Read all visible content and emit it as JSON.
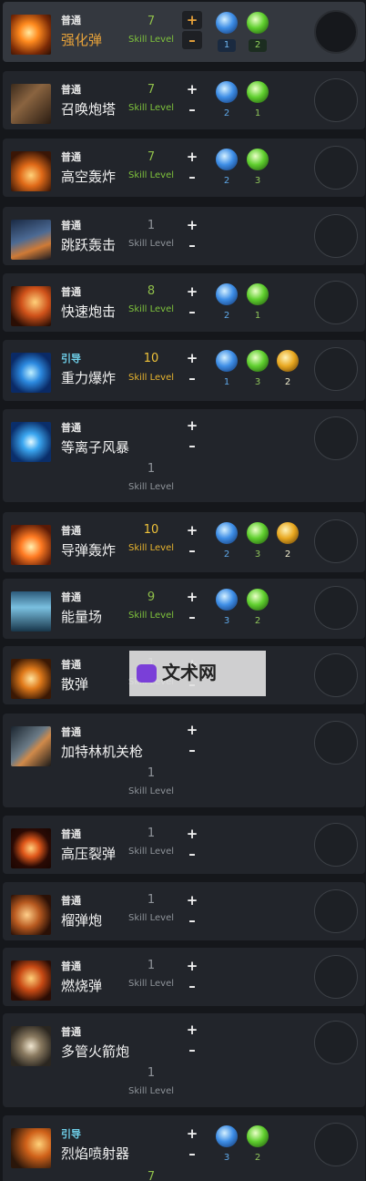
{
  "skill_level_label": "Skill Level",
  "skills": [
    {
      "type": "普通",
      "name": "强化弹",
      "level": "7",
      "runes": [
        {
          "icon": "blue-crystal-rune-icon",
          "count": "1"
        },
        {
          "icon": "green-up-rune-icon",
          "count": "2"
        }
      ]
    },
    {
      "type": "普通",
      "name": "召唤炮塔",
      "level": "7",
      "runes": [
        {
          "icon": "blue-timer-rune-icon",
          "count": "2"
        },
        {
          "icon": "green-slash-rune-icon",
          "count": "1"
        }
      ]
    },
    {
      "type": "普通",
      "name": "高空轰炸",
      "level": "7",
      "runes": [
        {
          "icon": "blue-dash-rune-icon",
          "count": "2"
        },
        {
          "icon": "green-claw-rune-icon",
          "count": "3"
        }
      ]
    },
    {
      "type": "普通",
      "name": "跳跃轰击",
      "level": "1",
      "runes": []
    },
    {
      "type": "普通",
      "name": "快速炮击",
      "level": "8",
      "runes": [
        {
          "icon": "blue-orb-up-rune-icon",
          "count": "2"
        },
        {
          "icon": "green-down-rune-icon",
          "count": "1"
        }
      ]
    },
    {
      "type": "引导",
      "name": "重力爆炸",
      "level": "10",
      "runes": [
        {
          "icon": "blue-claw-rune-icon",
          "count": "1"
        },
        {
          "icon": "green-anchor-rune-icon",
          "count": "3"
        },
        {
          "icon": "gold-swirl-rune-icon",
          "count": "2"
        }
      ]
    },
    {
      "type": "普通",
      "name": "等离子风暴",
      "level": "1",
      "runes": []
    },
    {
      "type": "普通",
      "name": "导弹轰炸",
      "level": "10",
      "runes": [
        {
          "icon": "blue-anchor-rune-icon",
          "count": "2"
        },
        {
          "icon": "green-lotus-rune-icon",
          "count": "3"
        },
        {
          "icon": "gold-sun-rune-icon",
          "count": "2"
        }
      ]
    },
    {
      "type": "普通",
      "name": "能量场",
      "level": "9",
      "runes": [
        {
          "icon": "blue-drop-rune-icon",
          "count": "3"
        },
        {
          "icon": "green-timer-rune-icon",
          "count": "2"
        }
      ]
    },
    {
      "type": "普通",
      "name": "散弹",
      "level": "1",
      "runes": []
    },
    {
      "type": "普通",
      "name": "加特林机关枪",
      "level": "1",
      "runes": []
    },
    {
      "type": "普通",
      "name": "高压裂弹",
      "level": "1",
      "runes": []
    },
    {
      "type": "普通",
      "name": "榴弹炮",
      "level": "1",
      "runes": []
    },
    {
      "type": "普通",
      "name": "燃烧弹",
      "level": "1",
      "runes": []
    },
    {
      "type": "普通",
      "name": "多管火箭炮",
      "level": "1",
      "runes": []
    },
    {
      "type": "引导",
      "name": "烈焰喷射器",
      "level": "7",
      "runes": [
        {
          "icon": "blue-orb-up-rune-icon",
          "count": "3"
        },
        {
          "icon": "green-target-rune-icon",
          "count": "2"
        }
      ]
    }
  ],
  "watermark": {
    "text": "文术网"
  }
}
